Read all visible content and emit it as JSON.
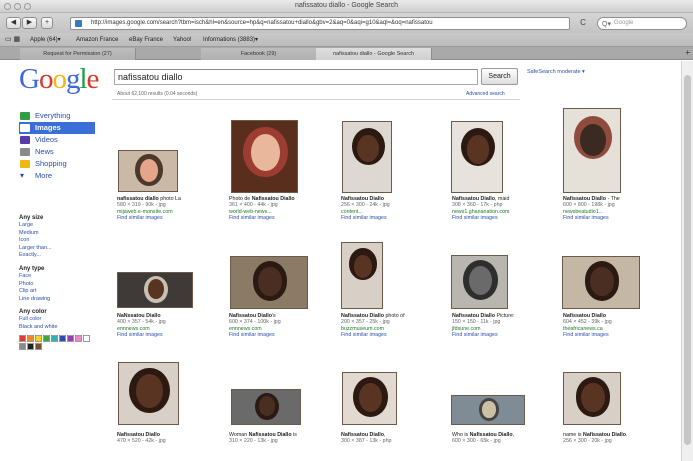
{
  "window": {
    "title": "nafissatou diallo - Google Search"
  },
  "toolbar": {
    "back": "◀",
    "forward": "▶",
    "add": "+",
    "url": "http://images.google.com/search?tbm=isch&hl=en&source=hp&q=nafissatou+diallo&gbv=2&aq=0&aqi=g10&aql=&oq=nafissatou",
    "reload": "C",
    "search_placeholder": "Google",
    "search_icon": "Q▾"
  },
  "bookmarks": [
    "Apple (64)▾",
    "Amazon France",
    "eBay France",
    "Yahoo!",
    "Informations (3883)▾"
  ],
  "tabs": [
    {
      "label": "Request for Permission (27)",
      "active": false
    },
    {
      "label": "Facebook (29)",
      "active": false
    },
    {
      "label": "nafissatou diallo - Google Search",
      "active": true
    }
  ],
  "google": {
    "logo": [
      "G",
      "o",
      "o",
      "g",
      "l",
      "e"
    ],
    "query": "nafissatou diallo",
    "search_button": "Search",
    "safesearch": "SafeSearch moderate ▾",
    "results_count": "About 62,100 results (0.04 seconds)",
    "advanced_search": "Advanced search"
  },
  "sidebar": {
    "nav": [
      {
        "label": "Everything",
        "icon": "everything-icon",
        "color": "#2f9e44",
        "active": false
      },
      {
        "label": "Images",
        "icon": "images-icon",
        "color": "#ffffff",
        "active": true
      },
      {
        "label": "Videos",
        "icon": "videos-icon",
        "color": "#5a3aa8",
        "active": false
      },
      {
        "label": "News",
        "icon": "news-icon",
        "color": "#8a8a8a",
        "active": false
      },
      {
        "label": "Shopping",
        "icon": "shopping-icon",
        "color": "#f2b713",
        "active": false
      },
      {
        "label": "More",
        "icon": "more-icon",
        "color": "#2a4eb0",
        "active": false
      }
    ],
    "size": {
      "heading": "Any size",
      "options": [
        "Large",
        "Medium",
        "Icon",
        "Larger than...",
        "Exactly..."
      ]
    },
    "type": {
      "heading": "Any type",
      "options": [
        "Face",
        "Photo",
        "Clip art",
        "Line drawing"
      ]
    },
    "color": {
      "heading": "Any color",
      "options": [
        "Full color",
        "Black and white"
      ]
    },
    "swatches": [
      "#e53b2e",
      "#f08a21",
      "#f5d21b",
      "#3aa83a",
      "#2fb0b8",
      "#2a4eb0",
      "#9b3bb6",
      "#ee89c5",
      "#ffffff",
      "#8a8a8a",
      "#222222",
      "#7a4f2a"
    ]
  },
  "results": [
    {
      "title_pre": "",
      "title_bold": "nafissatou diallo",
      "title_post": " photo La",
      "dims": "580 × 319 - 90k - jpg",
      "url": "mijaweb.e-monsite.com",
      "similar": "Find similar images",
      "palette": [
        "#c9b9a6",
        "#e4a58a",
        "#4b3a2c"
      ]
    },
    {
      "title_pre": "Photo de ",
      "title_bold": "Nafissatou Diallo",
      "title_post": "",
      "dims": "361 × 400 - 44k - jpg",
      "url": "world-web-news...",
      "similar": "Find similar images",
      "palette": [
        "#5a2e1c",
        "#e8b79c",
        "#9d3c33"
      ]
    },
    {
      "title_pre": "",
      "title_bold": "Nafissatou Diallo",
      "title_post": "",
      "dims": "256 × 300 - 24k - jpg",
      "url": "content...",
      "similar": "Find similar images",
      "palette": [
        "#ddd8d2",
        "#5a3423",
        "#2c1a12"
      ]
    },
    {
      "title_pre": "",
      "title_bold": "Nafissatou Diallo",
      "title_post": ", maid",
      "dims": "308 × 360 - 17k - php",
      "url": "news1.ghananation.com",
      "similar": "Find similar images",
      "palette": [
        "#e7e3dc",
        "#5a3423",
        "#2c1a12"
      ]
    },
    {
      "title_pre": "",
      "title_bold": "Nafissatou Diallo",
      "title_post": " - The",
      "dims": "600 × 800 - 198k - jpg",
      "url": "newsbeatudio1...",
      "similar": "Find similar images",
      "palette": [
        "#e5e1d9",
        "#3a2a22",
        "#8e4b3e"
      ]
    },
    {
      "title_pre": "",
      "title_bold": "NaNssatou Diallo",
      "title_post": "",
      "dims": "400 × 357 - 54k - jpg",
      "url": "ennnews.com",
      "similar": "Find similar images",
      "palette": [
        "#3f3a38",
        "#5a3423",
        "#c8c0b0"
      ]
    },
    {
      "title_pre": "",
      "title_bold": "Nafissatou Diallo",
      "title_post": "'s",
      "dims": "600 × 374 - 100k - jpg",
      "url": "ennnews.com",
      "similar": "Find similar images",
      "palette": [
        "#8a7a66",
        "#4a2e22",
        "#2a1a12"
      ]
    },
    {
      "title_pre": "",
      "title_bold": "Nafissatou Diallo",
      "title_post": " photo of",
      "dims": "200 × 357 - 25k - jpg",
      "url": "buzzmuseum.com",
      "similar": "Find similar images",
      "palette": [
        "#d8d0c6",
        "#5a3423",
        "#2c1a12"
      ]
    },
    {
      "title_pre": "",
      "title_bold": "Nafissatou Diallo",
      "title_post": " Picture:",
      "dims": "150 × 150 - 11k - jpg",
      "url": "jfdsune.com",
      "similar": "Find similar images",
      "palette": [
        "#b9b6b0",
        "#6a6a6a",
        "#2e2e2e"
      ]
    },
    {
      "title_pre": "",
      "title_bold": "Nafissatou Diallo",
      "title_post": "",
      "dims": "604 × 452 - 39k - jpg",
      "url": "theafricanews.ca",
      "similar": "Find similar images",
      "palette": [
        "#c4b7a4",
        "#4a2e22",
        "#2a1a12"
      ]
    },
    {
      "title_pre": "",
      "title_bold": "Nafissatou Diallo",
      "title_post": "",
      "dims": "470 × 520 - 42k - jpg",
      "url": "",
      "similar": "",
      "palette": [
        "#d8d0c6",
        "#5a3423",
        "#2c1a12"
      ]
    },
    {
      "title_pre": "Woman ",
      "title_bold": "Nafissatou Diallo",
      "title_post": " is",
      "dims": "310 × 220 - 13k - jpg",
      "url": "",
      "similar": "",
      "palette": [
        "#6a6a6a",
        "#4a2e22",
        "#2a1a12"
      ]
    },
    {
      "title_pre": "",
      "title_bold": "Nafissatou Diallo",
      "title_post": ",",
      "dims": "300 × 387 - 13k - php",
      "url": "",
      "similar": "",
      "palette": [
        "#e2dad0",
        "#5a3423",
        "#2c1a12"
      ]
    },
    {
      "title_pre": "Who is ",
      "title_bold": "Nafissatou Diallo",
      "title_post": ",",
      "dims": "600 × 300 - 65k - jpg",
      "url": "",
      "similar": "",
      "palette": [
        "#7f8c95",
        "#c9c1a2",
        "#444444"
      ]
    },
    {
      "title_pre": "name is ",
      "title_bold": "Nafissatou Diallo",
      "title_post": ".",
      "dims": "256 × 300 - 20k - jpg",
      "url": "",
      "similar": "",
      "palette": [
        "#d8d0c6",
        "#5a3423",
        "#2c1a12"
      ]
    }
  ]
}
